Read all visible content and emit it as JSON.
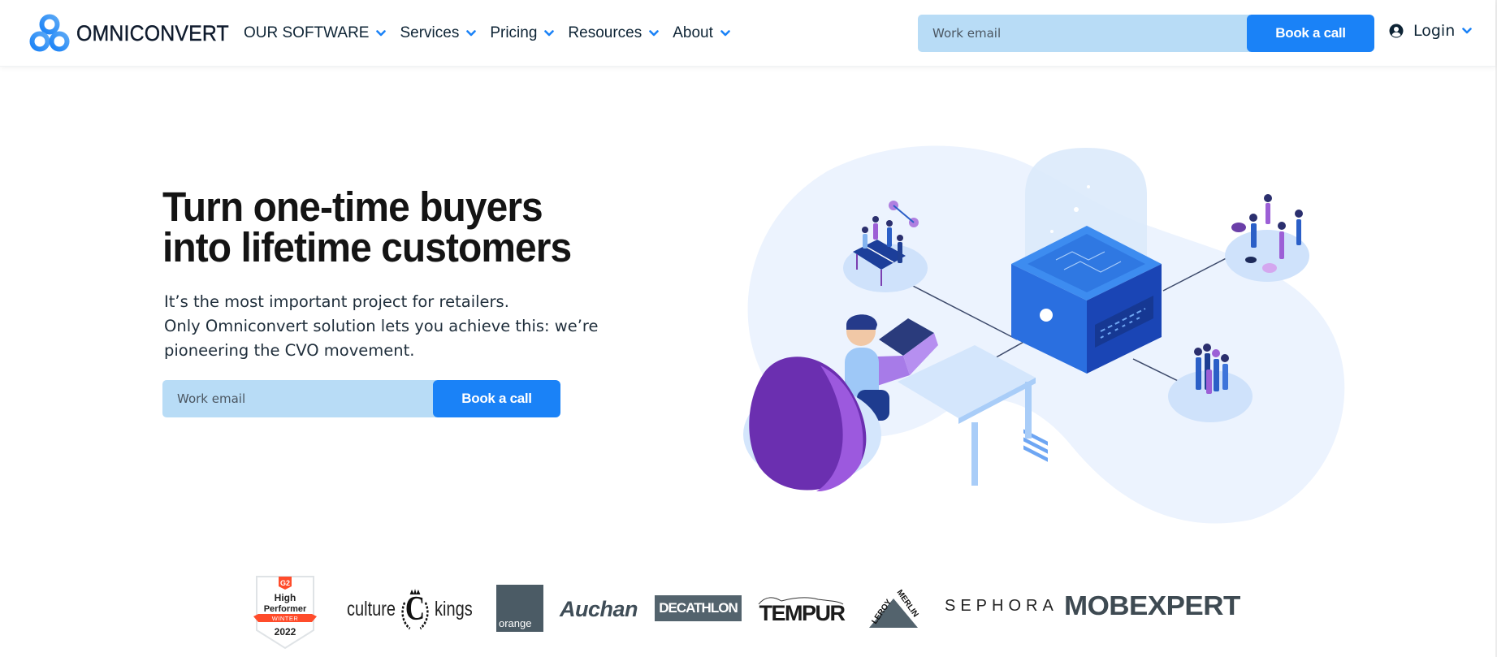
{
  "header": {
    "brand": "OMNICONVERT",
    "nav": [
      {
        "label": "OUR SOFTWARE"
      },
      {
        "label": "Services"
      },
      {
        "label": "Pricing"
      },
      {
        "label": "Resources"
      },
      {
        "label": "About"
      }
    ],
    "email_placeholder": "Work email",
    "cta_label": "Book a call",
    "login_label": "Login"
  },
  "hero": {
    "title_lines": [
      "Turn one-time buyers",
      "into lifetime customers"
    ],
    "paragraph_lines": [
      "It’s the most important project for retailers.",
      "Only Omniconvert solution lets you achieve this: we’re",
      "pioneering the CVO movement."
    ],
    "email_placeholder": "Work email",
    "cta_label": "Book a call"
  },
  "badge": {
    "brand": "G2",
    "line1": "High",
    "line2": "Performer",
    "season": "WINTER",
    "year": "2022"
  },
  "client_logos": [
    {
      "name": "culture kings",
      "left": "culture",
      "mid": "C",
      "right": "kings"
    },
    {
      "name": "orange",
      "text": "orange"
    },
    {
      "name": "Auchan",
      "text": "Auchan"
    },
    {
      "name": "Decathlon",
      "text": "DECATHLON"
    },
    {
      "name": "Tempur",
      "text": "TEMPUR"
    },
    {
      "name": "Leroy Merlin",
      "text": "LEROY MERLIN"
    },
    {
      "name": "Sephora",
      "text": "SEPHORA"
    },
    {
      "name": "Mobexpert",
      "text": "MOBEXPERT"
    }
  ],
  "colors": {
    "accent": "#1a82f7",
    "input_bg": "#b8dcf6",
    "text_dark": "#0e2435",
    "chevron": "#1a82f7"
  }
}
